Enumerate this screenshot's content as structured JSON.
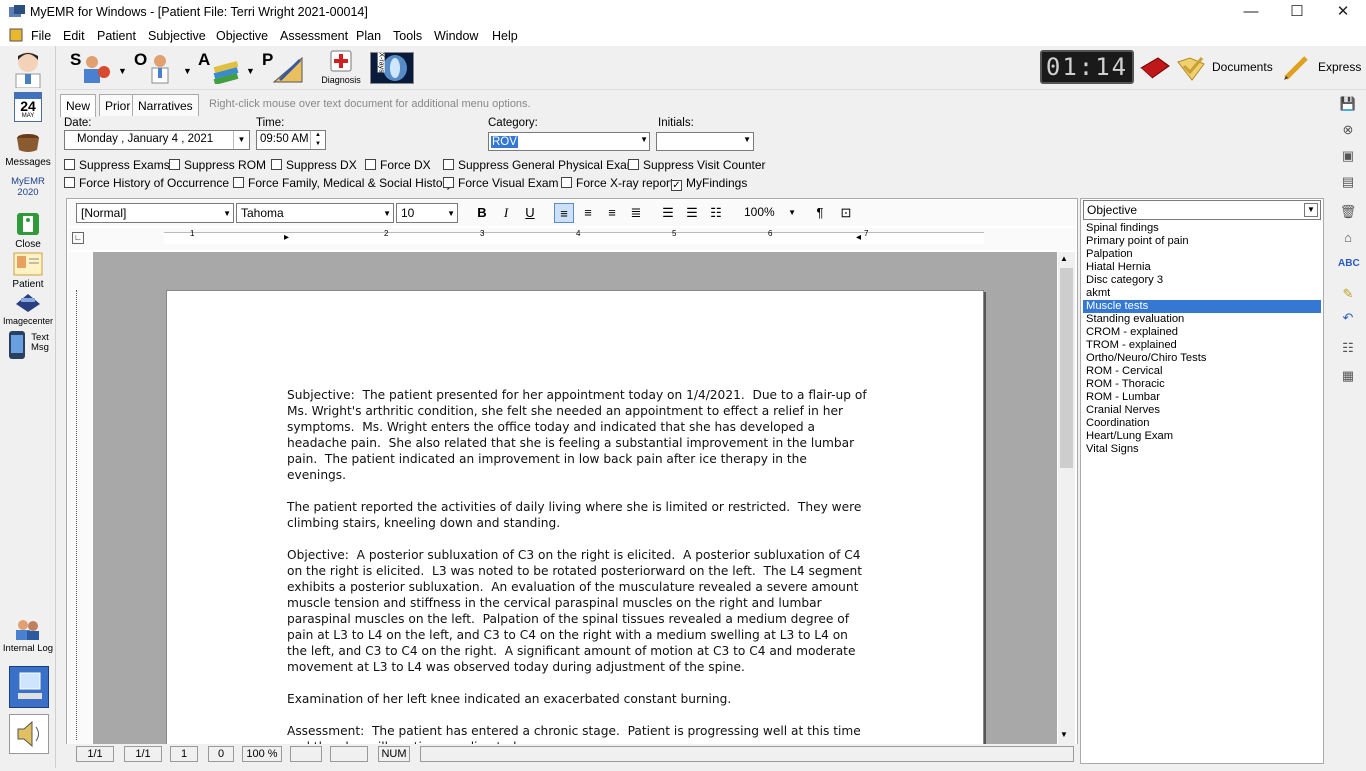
{
  "window": {
    "title": "MyEMR for Windows - [Patient File:  Terri Wright 2021-00014]",
    "minimize": "—",
    "maximize": "☐",
    "close": "✕"
  },
  "menu": [
    "File",
    "Edit",
    "Patient",
    "Subjective",
    "Objective",
    "Assessment",
    "Plan",
    "Tools",
    "Window",
    "Help"
  ],
  "mdi_controls": [
    "_",
    "🗗",
    "✕"
  ],
  "toolbar": {
    "soap_letters": [
      "S",
      "O",
      "A",
      "P"
    ],
    "diagnosis_label": "Diagnosis",
    "xrays_label": "X-rays",
    "clock": "01:14",
    "documents_label": "Documents",
    "express_label": "Express"
  },
  "leftbar": {
    "calendar_day": "24",
    "calendar_month": "MAY",
    "messages": "Messages",
    "myemr": "MyEMR",
    "myemr_year": "2020",
    "close": "Close",
    "patient": "Patient",
    "imagecenter": "Imagecenter",
    "textmsg": "Text Msg",
    "internal_log": "Internal Log"
  },
  "tabs": [
    "New",
    "Prior",
    "Narratives"
  ],
  "hint": "Right-click mouse over text document for additional menu options.",
  "form": {
    "date_label": "Date:",
    "date_value": "Monday   ,   January    4 , 2021",
    "time_label": "Time:",
    "time_value": "09:50 AM",
    "category_label": "Category:",
    "category_value": "ROV",
    "initials_label": "Initials:",
    "initials_value": ""
  },
  "checkboxes_row1": [
    {
      "label": "Suppress Exams",
      "checked": false
    },
    {
      "label": "Suppress ROM",
      "checked": false
    },
    {
      "label": "Suppress DX",
      "checked": false
    },
    {
      "label": "Force DX",
      "checked": false
    },
    {
      "label": "Suppress General Physical Exam",
      "checked": false
    },
    {
      "label": "Suppress Visit Counter",
      "checked": false
    }
  ],
  "checkboxes_row2": [
    {
      "label": "Force History of Occurrence",
      "checked": false
    },
    {
      "label": "Force Family, Medical & Social History",
      "checked": false
    },
    {
      "label": "Force Visual Exam",
      "checked": false
    },
    {
      "label": "Force X-ray report",
      "checked": false
    },
    {
      "label": "MyFindings",
      "checked": true
    }
  ],
  "format": {
    "style": "[Normal]",
    "font": "Tahoma",
    "size": "10",
    "zoom": "100%"
  },
  "ruler_numbers": [
    "1",
    "2",
    "3",
    "4",
    "5",
    "6",
    "7"
  ],
  "document": [
    "Subjective:  The patient presented for her appointment today on 1/4/2021.  Due to a flair-up of Ms. Wright's arthritic condition, she felt she needed an appointment to effect a relief in her symptoms.  Ms. Wright enters the office today and indicated that she has developed a headache pain.  She also related that she is feeling a substantial improvement in the lumbar pain.  The patient indicated an improvement in low back pain after ice therapy in the evenings.",
    "The patient reported the activities of daily living where she is limited or restricted.  They were climbing stairs, kneeling down and standing.",
    "Objective:  A posterior subluxation of C3 on the right is elicited.  A posterior subluxation of C4 on the right is elicited.  L3 was noted to be rotated posteriorward on the left.  The L4 segment exhibits a posterior subluxation.  An evaluation of the musculature revealed a severe amount muscle tension and stiffness in the cervical paraspinal muscles on the right and lumbar paraspinal muscles on the left.  Palpation of the spinal tissues revealed a medium degree of pain at L3 to L4 on the left, and C3 to C4 on the right with a medium swelling at L3 to L4 on the left, and C3 to C4 on the right.  A significant amount of motion at C3 to C4 and moderate movement at L3 to L4 was observed today during adjustment of the spine.",
    "Examination of her left knee indicated an exacerbated constant burning.",
    "Assessment:  The patient has entered a chronic stage.  Patient is progressing well at this time and the plan will continue as directed."
  ],
  "status": [
    "1/1",
    "1/1",
    "1",
    "0",
    "100 %",
    "",
    "",
    "NUM",
    ""
  ],
  "panel": {
    "selector": "Objective",
    "items": [
      "Spinal findings",
      "Primary point of pain",
      "Palpation",
      "Hiatal Hernia",
      "Disc category 3",
      "akmt",
      "Muscle tests",
      "Standing evaluation",
      "CROM - explained",
      "TROM - explained",
      "Ortho/Neuro/Chiro Tests",
      "ROM - Cervical",
      "ROM - Thoracic",
      "ROM - Lumbar",
      "Cranial Nerves",
      "Coordination",
      "Heart/Lung Exam",
      "Vital Signs"
    ],
    "selected_index": 6
  },
  "colors": {
    "selection": "#3478d4",
    "accent": "#c00000"
  }
}
